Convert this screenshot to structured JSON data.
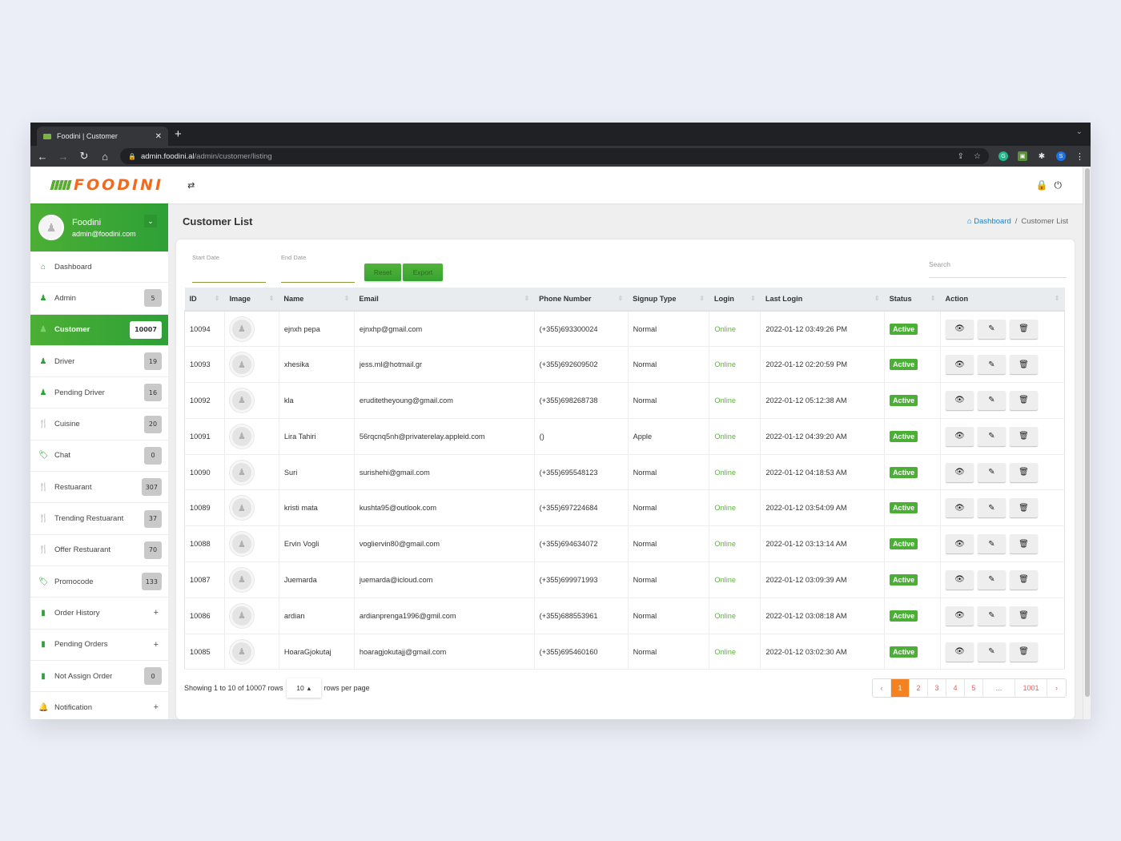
{
  "browser": {
    "tab_title": "Foodini | Customer",
    "tab_close": "✕",
    "new_tab": "+",
    "url_host": "admin.foodini.al",
    "url_path": "/admin/customer/listing",
    "ext_grammarly": "G",
    "ext_profile": "S"
  },
  "topbar": {
    "logo_text": "FOODINI",
    "toggle_icon": "⇄",
    "lock_icon": "🔒",
    "power_icon": "⏻"
  },
  "profile": {
    "name": "Foodini",
    "email": "admin@foodini.com"
  },
  "sidebar": {
    "items": [
      {
        "label": "Dashboard",
        "icon": "home-icon",
        "glyph": "⌂",
        "badge": null,
        "plus": false
      },
      {
        "label": "Admin",
        "icon": "user-icon",
        "glyph": "♟",
        "badge": "5",
        "plus": false
      },
      {
        "label": "Customer",
        "icon": "user-icon",
        "glyph": "♟",
        "badge": "10007",
        "plus": false,
        "active": true
      },
      {
        "label": "Driver",
        "icon": "user-icon",
        "glyph": "♟",
        "badge": "19",
        "plus": false
      },
      {
        "label": "Pending Driver",
        "icon": "user-icon",
        "glyph": "♟",
        "badge": "16",
        "plus": false
      },
      {
        "label": "Cuisine",
        "icon": "cutlery-icon",
        "glyph": "🍴",
        "badge": "20",
        "plus": false
      },
      {
        "label": "Chat",
        "icon": "tag-icon",
        "glyph": "🏷",
        "badge": "0",
        "plus": false
      },
      {
        "label": "Restuarant",
        "icon": "cutlery-icon",
        "glyph": "🍴",
        "badge": "307",
        "plus": false
      },
      {
        "label": "Trending Restuarant",
        "icon": "cutlery-icon",
        "glyph": "🍴",
        "badge": "37",
        "plus": false
      },
      {
        "label": "Offer Restuarant",
        "icon": "cutlery-icon",
        "glyph": "🍴",
        "badge": "70",
        "plus": false
      },
      {
        "label": "Promocode",
        "icon": "tag-icon",
        "glyph": "🏷",
        "badge": "133",
        "plus": false
      },
      {
        "label": "Order History",
        "icon": "file-icon",
        "glyph": "▮",
        "badge": null,
        "plus": true
      },
      {
        "label": "Pending Orders",
        "icon": "file-icon",
        "glyph": "▮",
        "badge": null,
        "plus": true
      },
      {
        "label": "Not Assign Order",
        "icon": "file-icon",
        "glyph": "▮",
        "badge": "0",
        "plus": false
      },
      {
        "label": "Notification",
        "icon": "bell-icon",
        "glyph": "🔔",
        "badge": null,
        "plus": true
      }
    ]
  },
  "page": {
    "title": "Customer List",
    "breadcrumb_home": "Dashboard",
    "breadcrumb_sep": "/",
    "breadcrumb_current": "Customer List"
  },
  "filters": {
    "start_date_label": "Start Date",
    "end_date_label": "End Date",
    "reset_label": "Reset",
    "export_label": "Export",
    "search_placeholder": "Search"
  },
  "table": {
    "columns": [
      "ID",
      "Image",
      "Name",
      "Email",
      "Phone Number",
      "Signup Type",
      "Login",
      "Last Login",
      "Status",
      "Action"
    ],
    "rows": [
      {
        "id": "10094",
        "name": "ejnxh pepa",
        "email": "ejnxhp@gmail.com",
        "phone": "(+355)693300024",
        "signup": "Normal",
        "login": "Online",
        "last_login": "2022-01-12 03:49:26 PM",
        "status": "Active"
      },
      {
        "id": "10093",
        "name": "xhesika",
        "email": "jess.ml@hotmail.gr",
        "phone": "(+355)692609502",
        "signup": "Normal",
        "login": "Online",
        "last_login": "2022-01-12 02:20:59 PM",
        "status": "Active"
      },
      {
        "id": "10092",
        "name": "kla",
        "email": "eruditetheyoung@gmail.com",
        "phone": "(+355)698268738",
        "signup": "Normal",
        "login": "Online",
        "last_login": "2022-01-12 05:12:38 AM",
        "status": "Active"
      },
      {
        "id": "10091",
        "name": "Lira Tahiri",
        "email": "56rqcnq5nh@privaterelay.appleid.com",
        "phone": "()",
        "signup": "Apple",
        "login": "Online",
        "last_login": "2022-01-12 04:39:20 AM",
        "status": "Active"
      },
      {
        "id": "10090",
        "name": "Suri",
        "email": "surishehi@gmail.com",
        "phone": "(+355)695548123",
        "signup": "Normal",
        "login": "Online",
        "last_login": "2022-01-12 04:18:53 AM",
        "status": "Active"
      },
      {
        "id": "10089",
        "name": "kristi mata",
        "email": "kushta95@outlook.com",
        "phone": "(+355)697224684",
        "signup": "Normal",
        "login": "Online",
        "last_login": "2022-01-12 03:54:09 AM",
        "status": "Active"
      },
      {
        "id": "10088",
        "name": "Ervin Vogli",
        "email": "vogliervin80@gmail.com",
        "phone": "(+355)694634072",
        "signup": "Normal",
        "login": "Online",
        "last_login": "2022-01-12 03:13:14 AM",
        "status": "Active"
      },
      {
        "id": "10087",
        "name": "Juemarda",
        "email": "juemarda@icloud.com",
        "phone": "(+355)699971993",
        "signup": "Normal",
        "login": "Online",
        "last_login": "2022-01-12 03:09:39 AM",
        "status": "Active"
      },
      {
        "id": "10086",
        "name": "ardian",
        "email": "ardianprenga1996@gmil.com",
        "phone": "(+355)688553961",
        "signup": "Normal",
        "login": "Online",
        "last_login": "2022-01-12 03:08:18 AM",
        "status": "Active"
      },
      {
        "id": "10085",
        "name": "HoaraGjokutaj",
        "email": "hoaragjokutajj@gmail.com",
        "phone": "(+355)695460160",
        "signup": "Normal",
        "login": "Online",
        "last_login": "2022-01-12 03:02:30 AM",
        "status": "Active"
      }
    ]
  },
  "footer": {
    "showing_text": "Showing 1 to 10 of 10007 rows",
    "page_size": "10",
    "rows_per_page": "rows per page",
    "pages": [
      "‹",
      "1",
      "2",
      "3",
      "4",
      "5",
      "...",
      "1001",
      "›"
    ],
    "current_page": "1"
  },
  "colors": {
    "brand_green": "#4caf35",
    "brand_orange": "#f26a1b",
    "active_page": "#f58220",
    "link_blue": "#1b7fc4"
  }
}
